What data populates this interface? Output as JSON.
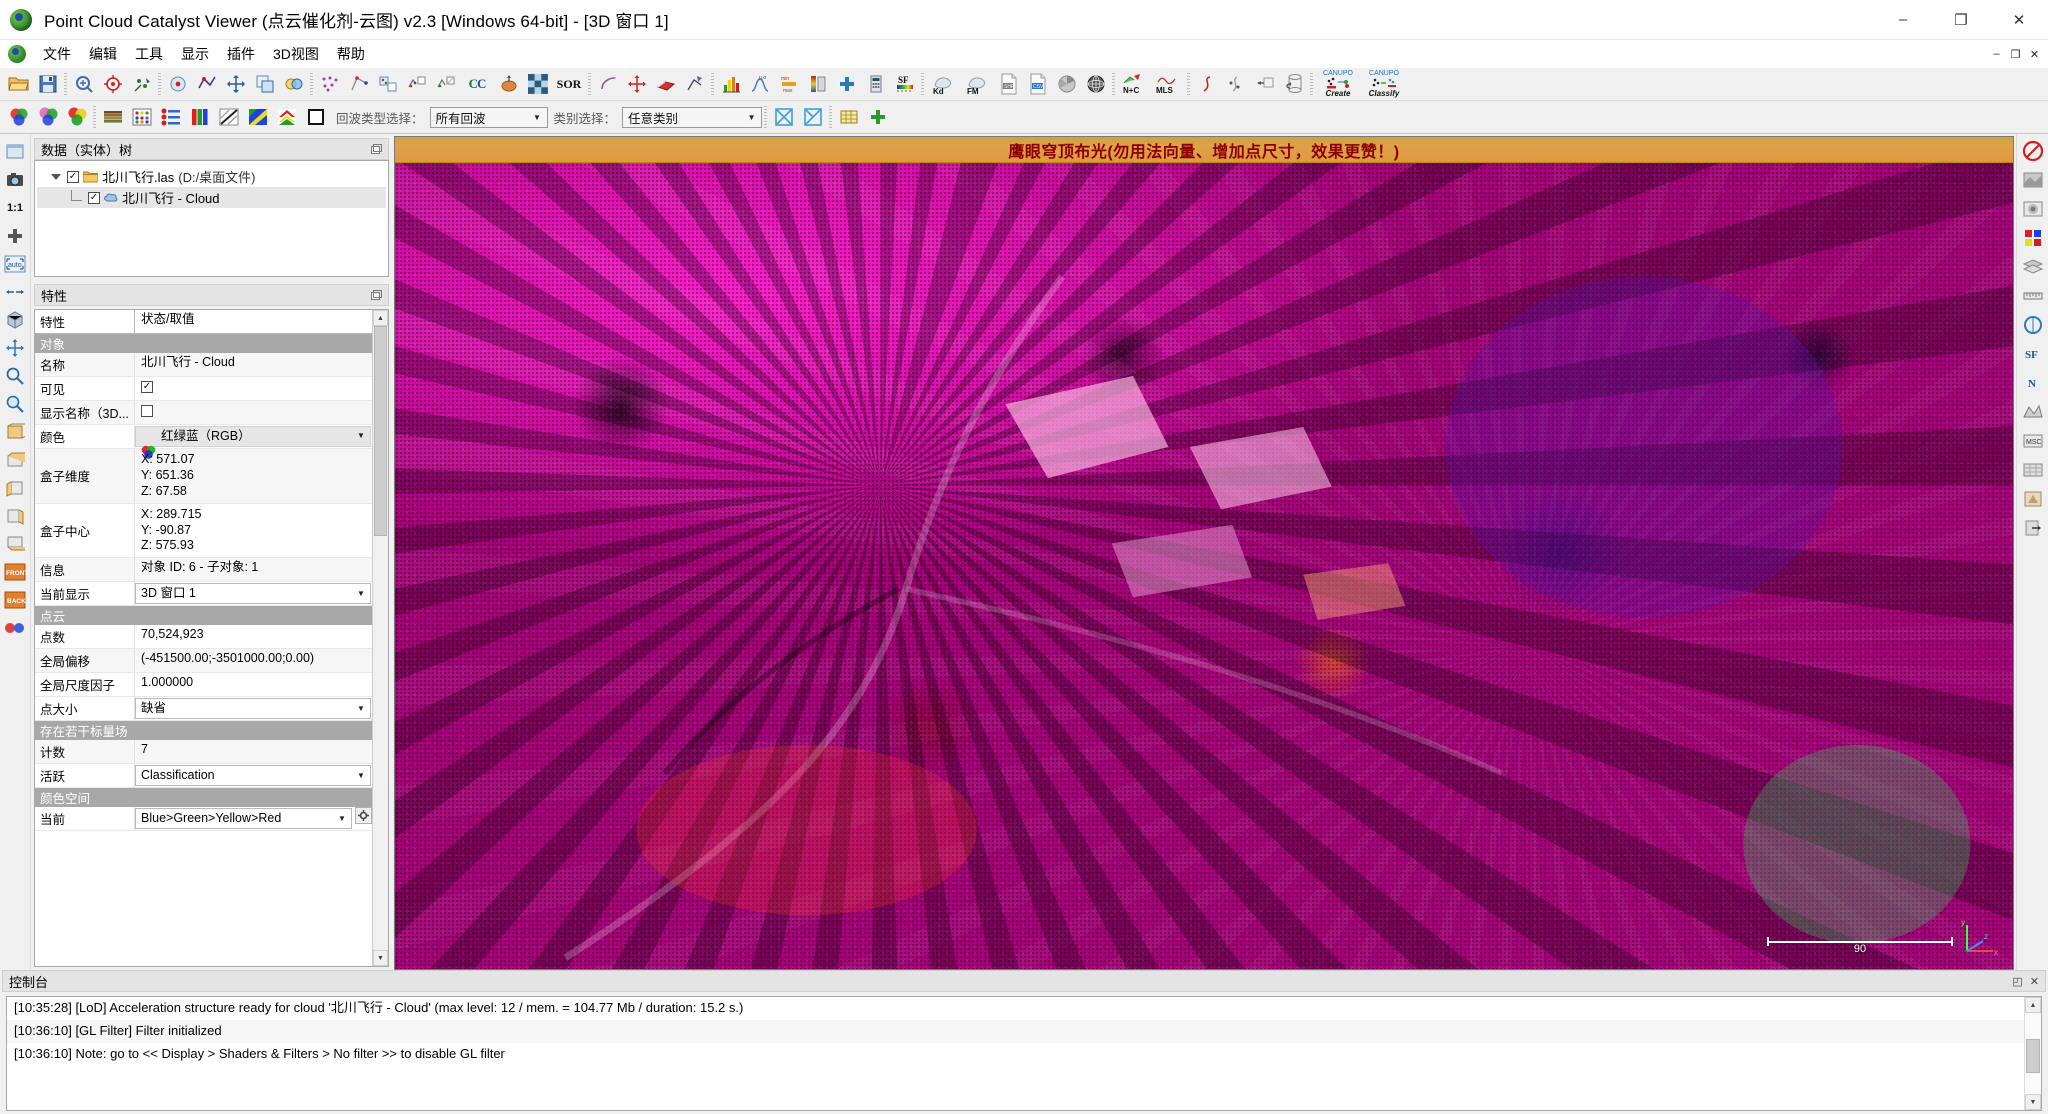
{
  "window": {
    "title": "Point Cloud Catalyst Viewer  (点云催化剂-云图)  v2.3  [Windows 64-bit] - [3D 窗口 1]",
    "app_icon": "yin-yang-icon",
    "minimize": "–",
    "maximize": "❐",
    "close": "✕",
    "mdi_minimize": "–",
    "mdi_restore": "❐",
    "mdi_close": "✕"
  },
  "menu": {
    "items": [
      {
        "label": "文件",
        "name": "menu-file"
      },
      {
        "label": "编辑",
        "name": "menu-edit"
      },
      {
        "label": "工具",
        "name": "menu-tools"
      },
      {
        "label": "显示",
        "name": "menu-display"
      },
      {
        "label": "插件",
        "name": "menu-plugins"
      },
      {
        "label": "3D视图",
        "name": "menu-3dview"
      },
      {
        "label": "帮助",
        "name": "menu-help"
      }
    ]
  },
  "toolbar_top": {
    "groups": [
      [
        "open-file-icon",
        "save-file-icon"
      ],
      [
        "global-zoom-icon",
        "set-pivot-icon",
        "pick-point-icon"
      ],
      [
        "point-picking-icon",
        "segment-icon",
        "translate-rotate-icon",
        "clone-icon",
        "merge-icon"
      ],
      [
        "subsample-icon",
        "registration-icon",
        "align-icon",
        "cloud-cloud-dist-icon",
        "cloud-mesh-dist-icon",
        "cc-icon",
        "normals-icon",
        "checker-icon",
        "sor-filter-icon"
      ],
      [
        "unroll-icon",
        "section-icon",
        "rasterize-icon",
        "trace-polyline-icon"
      ],
      [
        "histogram-icon",
        "statistics-icon",
        "minmax-icon",
        "color-ramp-icon",
        "add-icon",
        "calculator-icon",
        "sf-gradient-icon"
      ],
      [
        "kd-tree-icon",
        "fm-icon",
        "shp-export-icon",
        "csv-export-icon",
        "pie-icon",
        "sphere-icon"
      ],
      [
        "n-plus-c-icon",
        "mls-icon"
      ],
      [
        "curve-icon",
        "scatter-icon",
        "transform-icon",
        "rotate-cylinder-icon"
      ],
      [
        "canupo-create-icon",
        "canupo-classify-icon"
      ]
    ],
    "canupo_create_top": "CANUPO",
    "canupo_create_bottom": "Create",
    "canupo_classify_top": "CANUPO",
    "canupo_classify_bottom": "Classify",
    "kd_label": "Kd",
    "fm_label": "FM",
    "sor_label": "SOR",
    "cc_label": "CC",
    "sf_label": "SF",
    "nc_label": "N+C",
    "mls_label": "MLS",
    "shp_label": "SHP",
    "csv_label": "CSV"
  },
  "toolbar_second": {
    "icons_left": [
      "rgb-color-icon",
      "rgb-color-2-icon",
      "rgb-color-3-icon"
    ],
    "icons_mid": [
      "gradient-bars-icon",
      "color-dots-icon",
      "scalar-list-icon",
      "rgb-bars-icon",
      "hatch-icon",
      "diag-color-icon",
      "chevron-color-icon",
      "square-outline-icon"
    ],
    "echo_label": "回波类型选择：",
    "echo_value": "所有回波",
    "class_label": "类别选择：",
    "class_value": "任意类别",
    "icons_right": [
      "blue-cross-icon",
      "blue-x-icon",
      "grid-icon",
      "plus-green-icon"
    ]
  },
  "left_rail": {
    "buttons": [
      "viewport-icon",
      "camera-icon",
      "ratio-1-1-icon",
      "zoom-plus-icon",
      "auto-icon",
      "arrows-icon",
      "cube-icon",
      "move-icon",
      "zoom-search-icon",
      "magnifier-icon",
      "box-front-icon",
      "box-top-icon",
      "box-left-icon",
      "box-right-icon",
      "box-bottom-icon",
      "front-view-icon",
      "back-view-icon",
      "colors-icon"
    ],
    "auto_label": "auto",
    "ratio_label": "1:1",
    "front_label": "FRONT",
    "back_label": "BACK"
  },
  "right_rail": {
    "buttons": [
      "no-filter-icon",
      "edl-shader-icon",
      "ssao-icon",
      "color-scale-icon",
      "layers-icon",
      "ruler-icon",
      "circle-icon",
      "sf-icon",
      "n-icon",
      "mesh-icon",
      "msc-icon",
      "grid2-icon",
      "exit-icon",
      "app-icon"
    ]
  },
  "tree_panel": {
    "title": "数据（实体）树",
    "nodes": [
      {
        "label": "北川飞行.las",
        "path": "(D:/桌面文件)",
        "checked": true,
        "icon": "folder-icon",
        "level": 0,
        "expanded": true
      },
      {
        "label": "北川飞行 - Cloud",
        "path": "",
        "checked": true,
        "icon": "cloud-icon",
        "level": 1,
        "selected": true
      }
    ]
  },
  "properties": {
    "title": "特性",
    "header": {
      "key": "特性",
      "value": "状态/取值"
    },
    "rows": [
      {
        "type": "section",
        "key": "对象"
      },
      {
        "type": "text",
        "key": "名称",
        "value": "北川飞行 - Cloud",
        "alt": true
      },
      {
        "type": "checkbox",
        "key": "可见",
        "checked": true
      },
      {
        "type": "checkbox",
        "key": "显示名称（3D...",
        "checked": false,
        "alt": true
      },
      {
        "type": "combo-rgb",
        "key": "颜色",
        "value": "红绿蓝（RGB）"
      },
      {
        "type": "multiline",
        "key": "盒子维度",
        "value": "X: 571.07\nY: 651.36\nZ: 67.58",
        "alt": true
      },
      {
        "type": "multiline",
        "key": "盒子中心",
        "value": "X: 289.715\nY: -90.87\nZ: 575.93"
      },
      {
        "type": "text",
        "key": "信息",
        "value": "对象 ID: 6 - 子对象: 1",
        "alt": true
      },
      {
        "type": "combo",
        "key": "当前显示",
        "value": "3D 窗口 1"
      },
      {
        "type": "section",
        "key": "点云"
      },
      {
        "type": "text",
        "key": "点数",
        "value": "70,524,923"
      },
      {
        "type": "text",
        "key": "全局偏移",
        "value": "(-451500.00;-3501000.00;0.00)",
        "alt": true
      },
      {
        "type": "text",
        "key": "全局尺度因子",
        "value": "1.000000"
      },
      {
        "type": "combo",
        "key": "点大小",
        "value": "缺省"
      },
      {
        "type": "section",
        "key": "存在若干标量场"
      },
      {
        "type": "text",
        "key": "计数",
        "value": "7",
        "alt": true
      },
      {
        "type": "combo",
        "key": "活跃",
        "value": "Classification"
      },
      {
        "type": "section",
        "key": "颜色空间"
      },
      {
        "type": "combo-btn",
        "key": "当前",
        "value": "Blue>Green>Yellow>Red"
      }
    ]
  },
  "view": {
    "banner": "鹰眼穹顶布光(勿用法向量、增加点尺寸，效果更赞！)",
    "scale_value": "90",
    "axis_x": "x",
    "axis_y": "y",
    "axis_z": "z"
  },
  "console": {
    "title": "控制台",
    "lines": [
      "[10:35:28] [LoD] Acceleration structure ready for cloud '北川飞行 - Cloud' (max level: 12 / mem. = 104.77 Mb / duration: 15.2 s.)",
      "[10:36:10] [GL Filter] Filter initialized",
      "[10:36:10] Note: go to << Display > Shaders & Filters > No filter >> to disable GL filter"
    ],
    "float_icon": "◰",
    "close_icon": "✕"
  },
  "colors": {
    "accent": "#0b6ec7",
    "section_bg": "#a8a8a8",
    "banner_bg": "#dd9a3f",
    "banner_fg": "#8a0000",
    "chrome": "#f0f0f0"
  }
}
